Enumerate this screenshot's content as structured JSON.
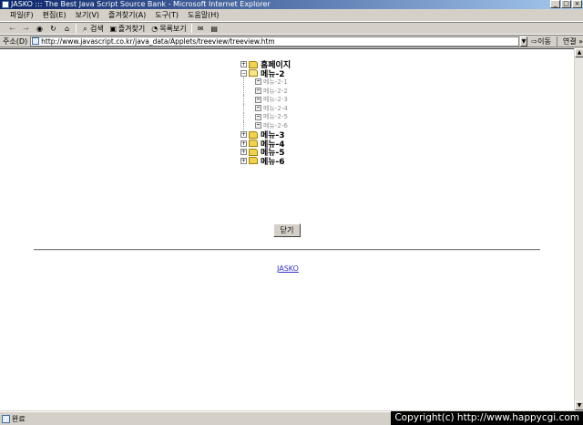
{
  "window": {
    "title": "JASKO ::: The Best Java Script Source Bank - Microsoft Internet Explorer",
    "buttons": {
      "minimize": "_",
      "maximize": "□",
      "close": "×"
    }
  },
  "menu": [
    "파일(F)",
    "편집(E)",
    "보기(V)",
    "즐겨찾기(A)",
    "도구(T)",
    "도움말(H)"
  ],
  "toolbar": {
    "back": "←",
    "forward": "→",
    "stop": "◉",
    "refresh": "↻",
    "home": "⌂",
    "search": "검색",
    "favorites": "즐겨찾기",
    "history": "목록보기",
    "mail": "✉",
    "print": "▤"
  },
  "address": {
    "label": "주소(D)",
    "url": "http://www.javascript.co.kr/java_data/Applets/treeview/treeview.htm",
    "dropdown": "▼",
    "go": "이동",
    "links": "연결 »"
  },
  "tree": {
    "items": [
      {
        "label": "홈페이지",
        "toggle": "+"
      },
      {
        "label": "메뉴-2",
        "toggle": "−",
        "children": [
          "메뉴-2-1",
          "메뉴-2-2",
          "메뉴-2-3",
          "메뉴-2-4",
          "메뉴-2-5",
          "메뉴-2-6"
        ]
      },
      {
        "label": "메뉴-3",
        "toggle": "+"
      },
      {
        "label": "메뉴-4",
        "toggle": "+"
      },
      {
        "label": "메뉴-5",
        "toggle": "+"
      },
      {
        "label": "메뉴-6",
        "toggle": "+"
      }
    ]
  },
  "close_button": "닫기",
  "footer_link": "JASKO",
  "status": {
    "text": "완료"
  },
  "watermark": "Copyright(c) http://www.happycgi.com",
  "scrollbar": {
    "up": "▲",
    "down": "▼"
  }
}
